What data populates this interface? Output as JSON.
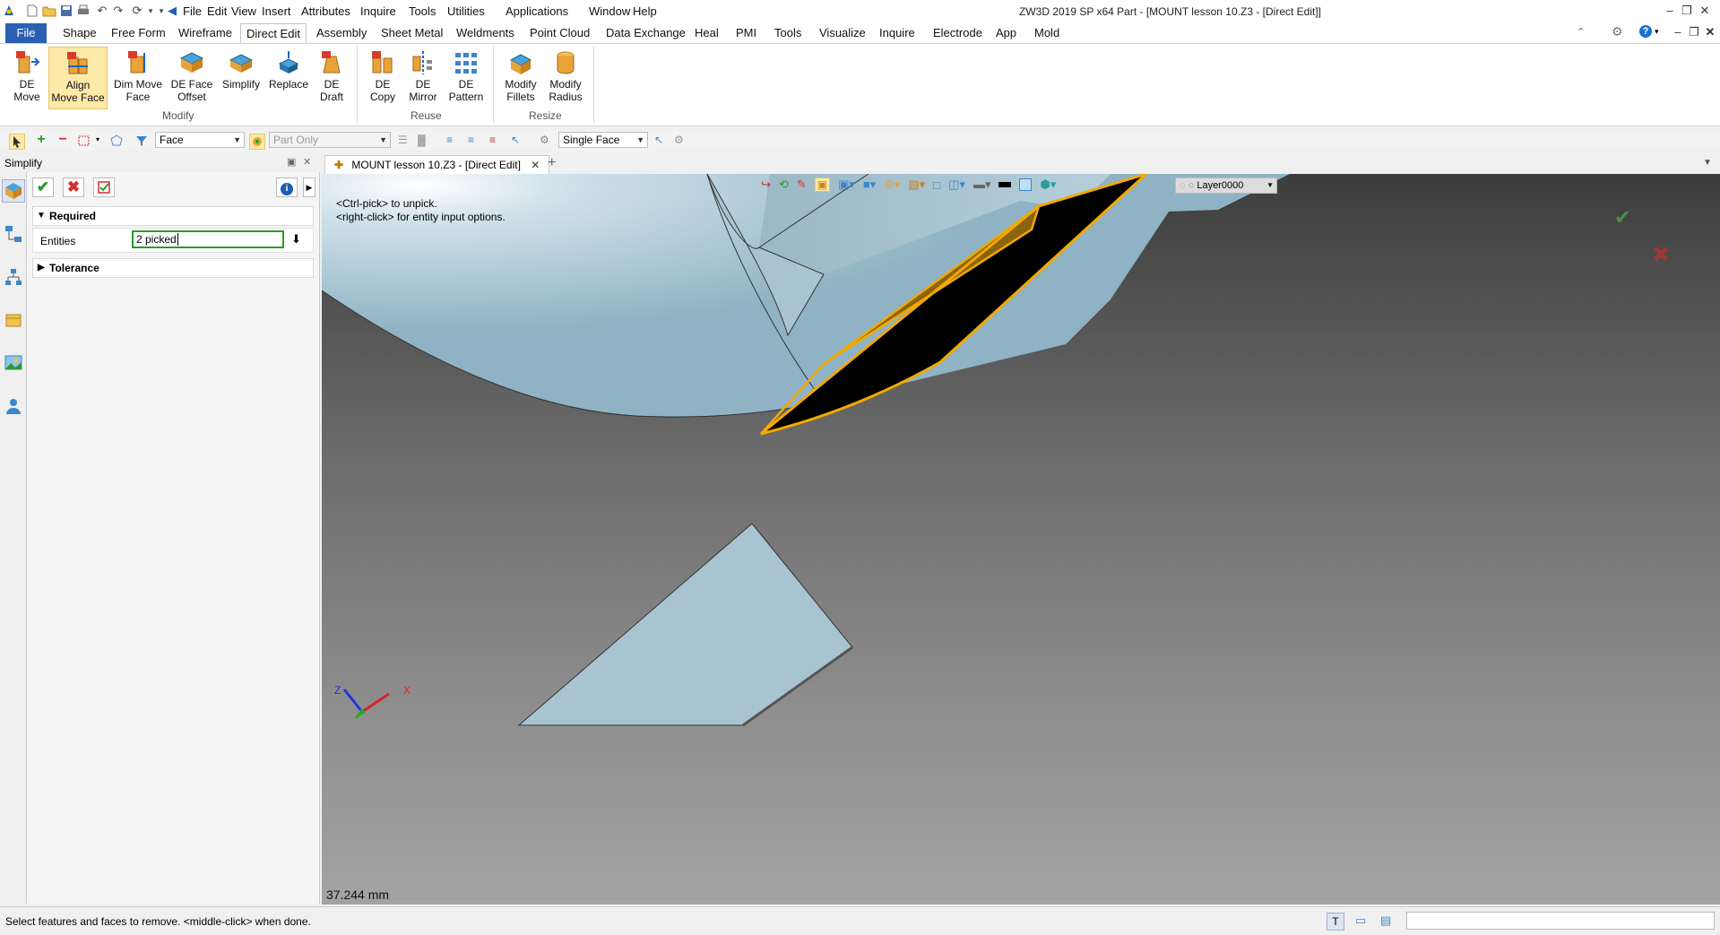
{
  "app": {
    "title": "ZW3D 2019 SP x64        Part - [MOUNT lesson 10.Z3 - [Direct Edit]]"
  },
  "menu": [
    "File",
    "Edit",
    "View",
    "Insert",
    "Attributes",
    "Inquire",
    "Tools",
    "Utilities",
    "Applications",
    "Window",
    "Help"
  ],
  "ribbon_tabs": [
    "File",
    "Shape",
    "Free Form",
    "Wireframe",
    "Direct Edit",
    "Assembly",
    "Sheet Metal",
    "Weldments",
    "Point Cloud",
    "Data Exchange",
    "Heal",
    "PMI",
    "Tools",
    "Visualize",
    "Inquire",
    "Electrode",
    "App",
    "Mold"
  ],
  "ribbon_active_tab": "Direct Edit",
  "ribbon": {
    "modify": {
      "label": "Modify",
      "buttons": [
        {
          "line1": "DE",
          "line2": "Move"
        },
        {
          "line1": "Align",
          "line2": "Move Face"
        },
        {
          "line1": "Dim Move",
          "line2": "Face"
        },
        {
          "line1": "DE Face",
          "line2": "Offset"
        },
        {
          "line1": "Simplify",
          "line2": ""
        },
        {
          "line1": "Replace",
          "line2": ""
        },
        {
          "line1": "DE",
          "line2": "Draft"
        }
      ]
    },
    "reuse": {
      "label": "Reuse",
      "buttons": [
        {
          "line1": "DE",
          "line2": "Copy"
        },
        {
          "line1": "DE",
          "line2": "Mirror"
        },
        {
          "line1": "DE",
          "line2": "Pattern"
        }
      ]
    },
    "resize": {
      "label": "Resize",
      "buttons": [
        {
          "line1": "Modify",
          "line2": "Fillets"
        },
        {
          "line1": "Modify",
          "line2": "Radius"
        }
      ]
    }
  },
  "toolbar": {
    "filter_value": "Face",
    "scope_value": "Part Only",
    "pick_mode_value": "Single Face"
  },
  "panel": {
    "title": "Simplify",
    "required_label": "Required",
    "entities_label": "Entities",
    "entities_value": "2 picked",
    "tolerance_label": "Tolerance"
  },
  "document_tab": {
    "label": "MOUNT lesson 10.Z3 - [Direct Edit]"
  },
  "viewport": {
    "hint_line1": "<Ctrl-pick> to unpick.",
    "hint_line2": "<right-click> for entity input options.",
    "layer": "Layer0000",
    "measurement": "37.244 mm",
    "axis_x": "X",
    "axis_z": "Z"
  },
  "status": {
    "prompt": "Select features and faces to remove.  <middle-click> when done."
  },
  "colors": {
    "accent": "#2b5fb3",
    "face": "#a9c4d1",
    "selection": "#f2a900"
  }
}
